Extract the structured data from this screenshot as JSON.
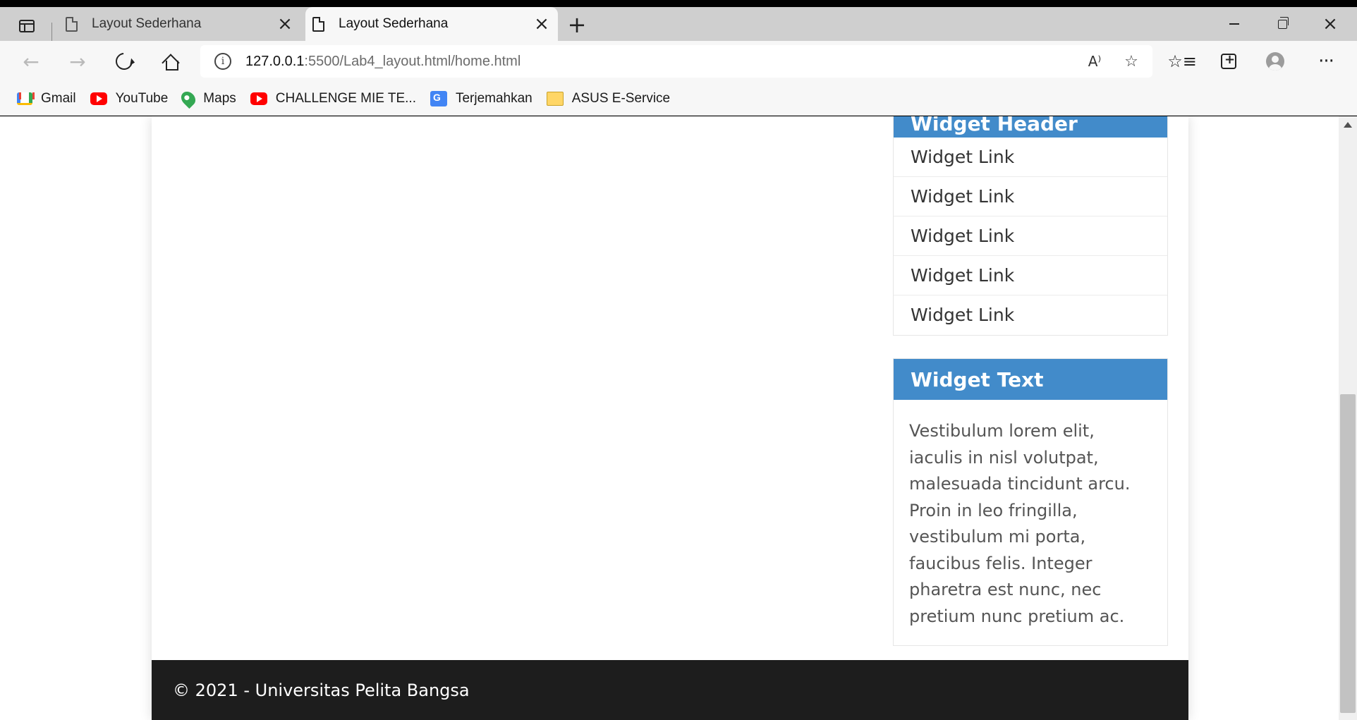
{
  "browser": {
    "tabs": [
      {
        "title": "Layout Sederhana",
        "active": false
      },
      {
        "title": "Layout Sederhana",
        "active": true
      }
    ],
    "new_tab_label": "+",
    "address": {
      "host": "127.0.0.1",
      "path": ":5500/Lab4_layout.html/home.html"
    },
    "bookmarks": [
      {
        "label": "Gmail",
        "icon": "gmail-icon"
      },
      {
        "label": "YouTube",
        "icon": "youtube-icon"
      },
      {
        "label": "Maps",
        "icon": "maps-icon"
      },
      {
        "label": "CHALLENGE MIE TE...",
        "icon": "youtube-icon"
      },
      {
        "label": "Terjemahkan",
        "icon": "translate-icon"
      },
      {
        "label": "ASUS E-Service",
        "icon": "folder-icon"
      }
    ]
  },
  "page": {
    "sidebar": {
      "nav_widget": {
        "header": "Widget Header",
        "links": [
          "Widget Link",
          "Widget Link",
          "Widget Link",
          "Widget Link",
          "Widget Link"
        ]
      },
      "text_widget": {
        "header": "Widget Text",
        "body": "Vestibulum lorem elit, iaculis in nisl volutpat, malesuada tincidunt arcu. Proin in leo fringilla, vestibulum mi porta, faucibus felis. Integer pharetra est nunc, nec pretium nunc pretium ac."
      }
    },
    "footer": {
      "text": "© 2021 - Universitas Pelita Bangsa"
    }
  },
  "colors": {
    "widget_header_bg": "#428bca",
    "footer_bg": "#1d1d1d"
  }
}
